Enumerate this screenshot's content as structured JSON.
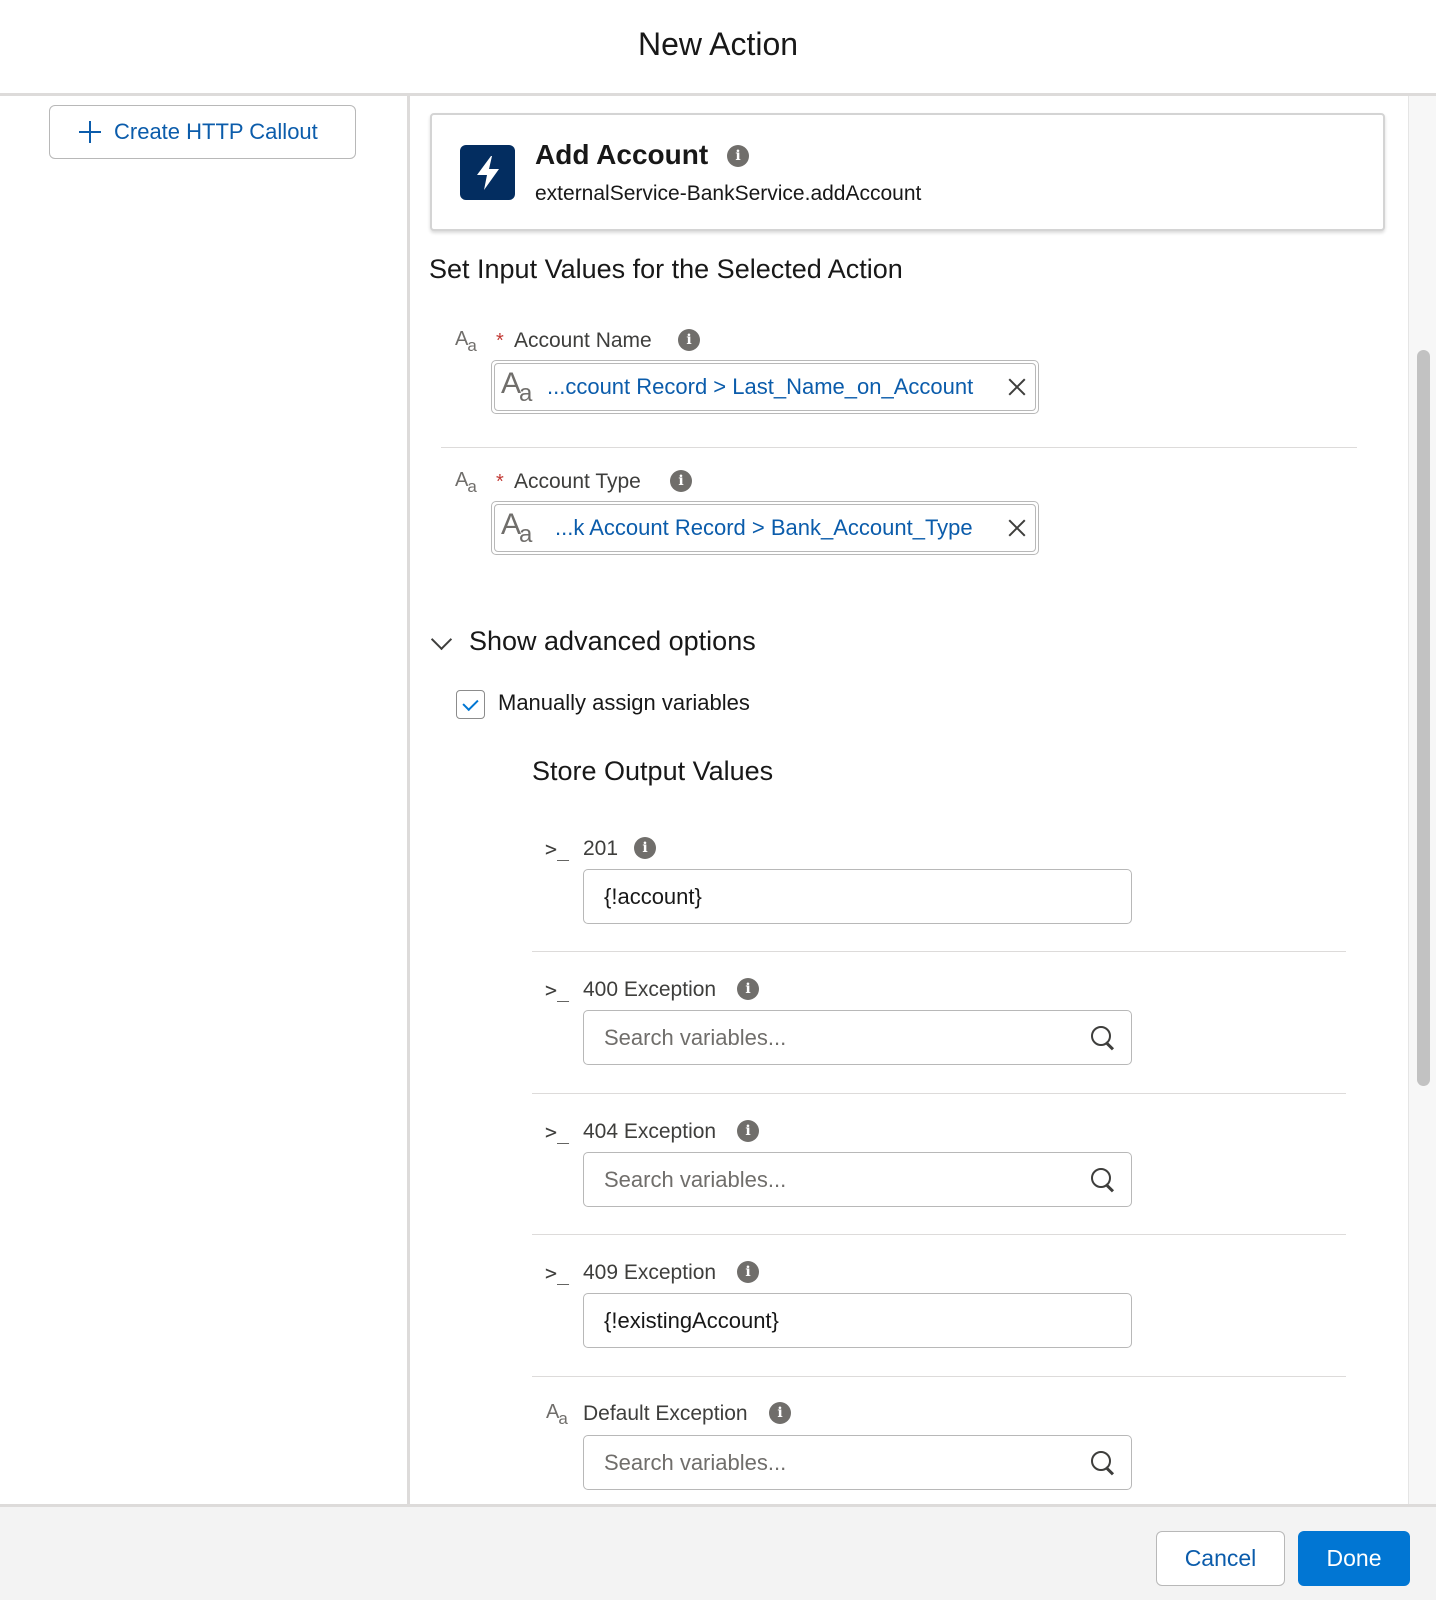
{
  "modal": {
    "title": "New Action"
  },
  "left_pane": {
    "create_callout_label": "Create HTTP Callout"
  },
  "action": {
    "title": "Add Account",
    "api_name": "externalService-BankService.addAccount",
    "icon": "lightning-bolt-icon"
  },
  "inputs": {
    "heading": "Set Input Values for the Selected Action",
    "fields": [
      {
        "label": "Account Name",
        "required_marker": "*",
        "type_icon": "Aa",
        "value": "...ccount Record > Last_Name_on_Account"
      },
      {
        "label": "Account Type",
        "required_marker": "*",
        "type_icon": "Aa",
        "value": "...k Account Record > Bank_Account_Type"
      }
    ]
  },
  "advanced": {
    "toggle_label": "Show advanced options",
    "manual_assign_label": "Manually assign variables",
    "manual_assign_checked": true
  },
  "outputs": {
    "heading": "Store Output Values",
    "fields": [
      {
        "label": "201",
        "type_icon": ">_",
        "value": "{!account}",
        "placeholder": ""
      },
      {
        "label": "400 Exception",
        "type_icon": ">_",
        "value": "",
        "placeholder": "Search variables..."
      },
      {
        "label": "404 Exception",
        "type_icon": ">_",
        "value": "",
        "placeholder": "Search variables..."
      },
      {
        "label": "409 Exception",
        "type_icon": ">_",
        "value": "{!existingAccount}",
        "placeholder": ""
      },
      {
        "label": "Default Exception",
        "type_icon": "Aa",
        "value": "",
        "placeholder": "Search variables..."
      }
    ]
  },
  "footer": {
    "cancel_label": "Cancel",
    "done_label": "Done"
  },
  "colors": {
    "brand_blue": "#0176d3",
    "link_blue": "#0b5cab",
    "action_icon_bg": "#032d60",
    "required_red": "#c23934"
  }
}
